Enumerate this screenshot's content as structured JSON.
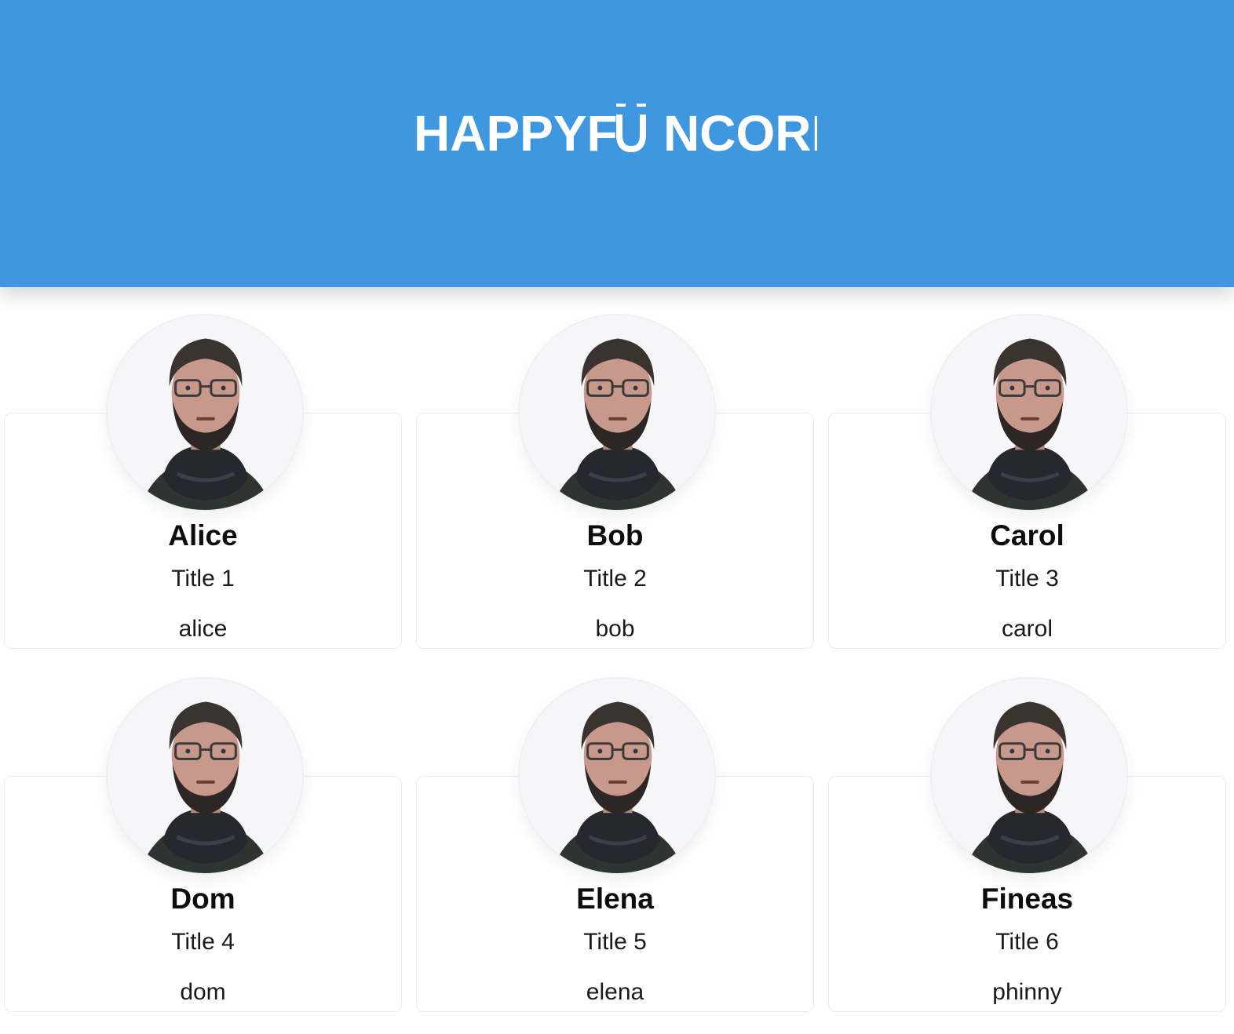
{
  "header": {
    "logo_text": "HAPPYFUNCORP",
    "background_color": "#3f97df"
  },
  "people": [
    {
      "name": "Alice",
      "title": "Title 1",
      "handle": "alice"
    },
    {
      "name": "Bob",
      "title": "Title 2",
      "handle": "bob"
    },
    {
      "name": "Carol",
      "title": "Title 3",
      "handle": "carol"
    },
    {
      "name": "Dom",
      "title": "Title 4",
      "handle": "dom"
    },
    {
      "name": "Elena",
      "title": "Title 5",
      "handle": "elena"
    },
    {
      "name": "Fineas",
      "title": "Title 6",
      "handle": "phinny"
    }
  ]
}
